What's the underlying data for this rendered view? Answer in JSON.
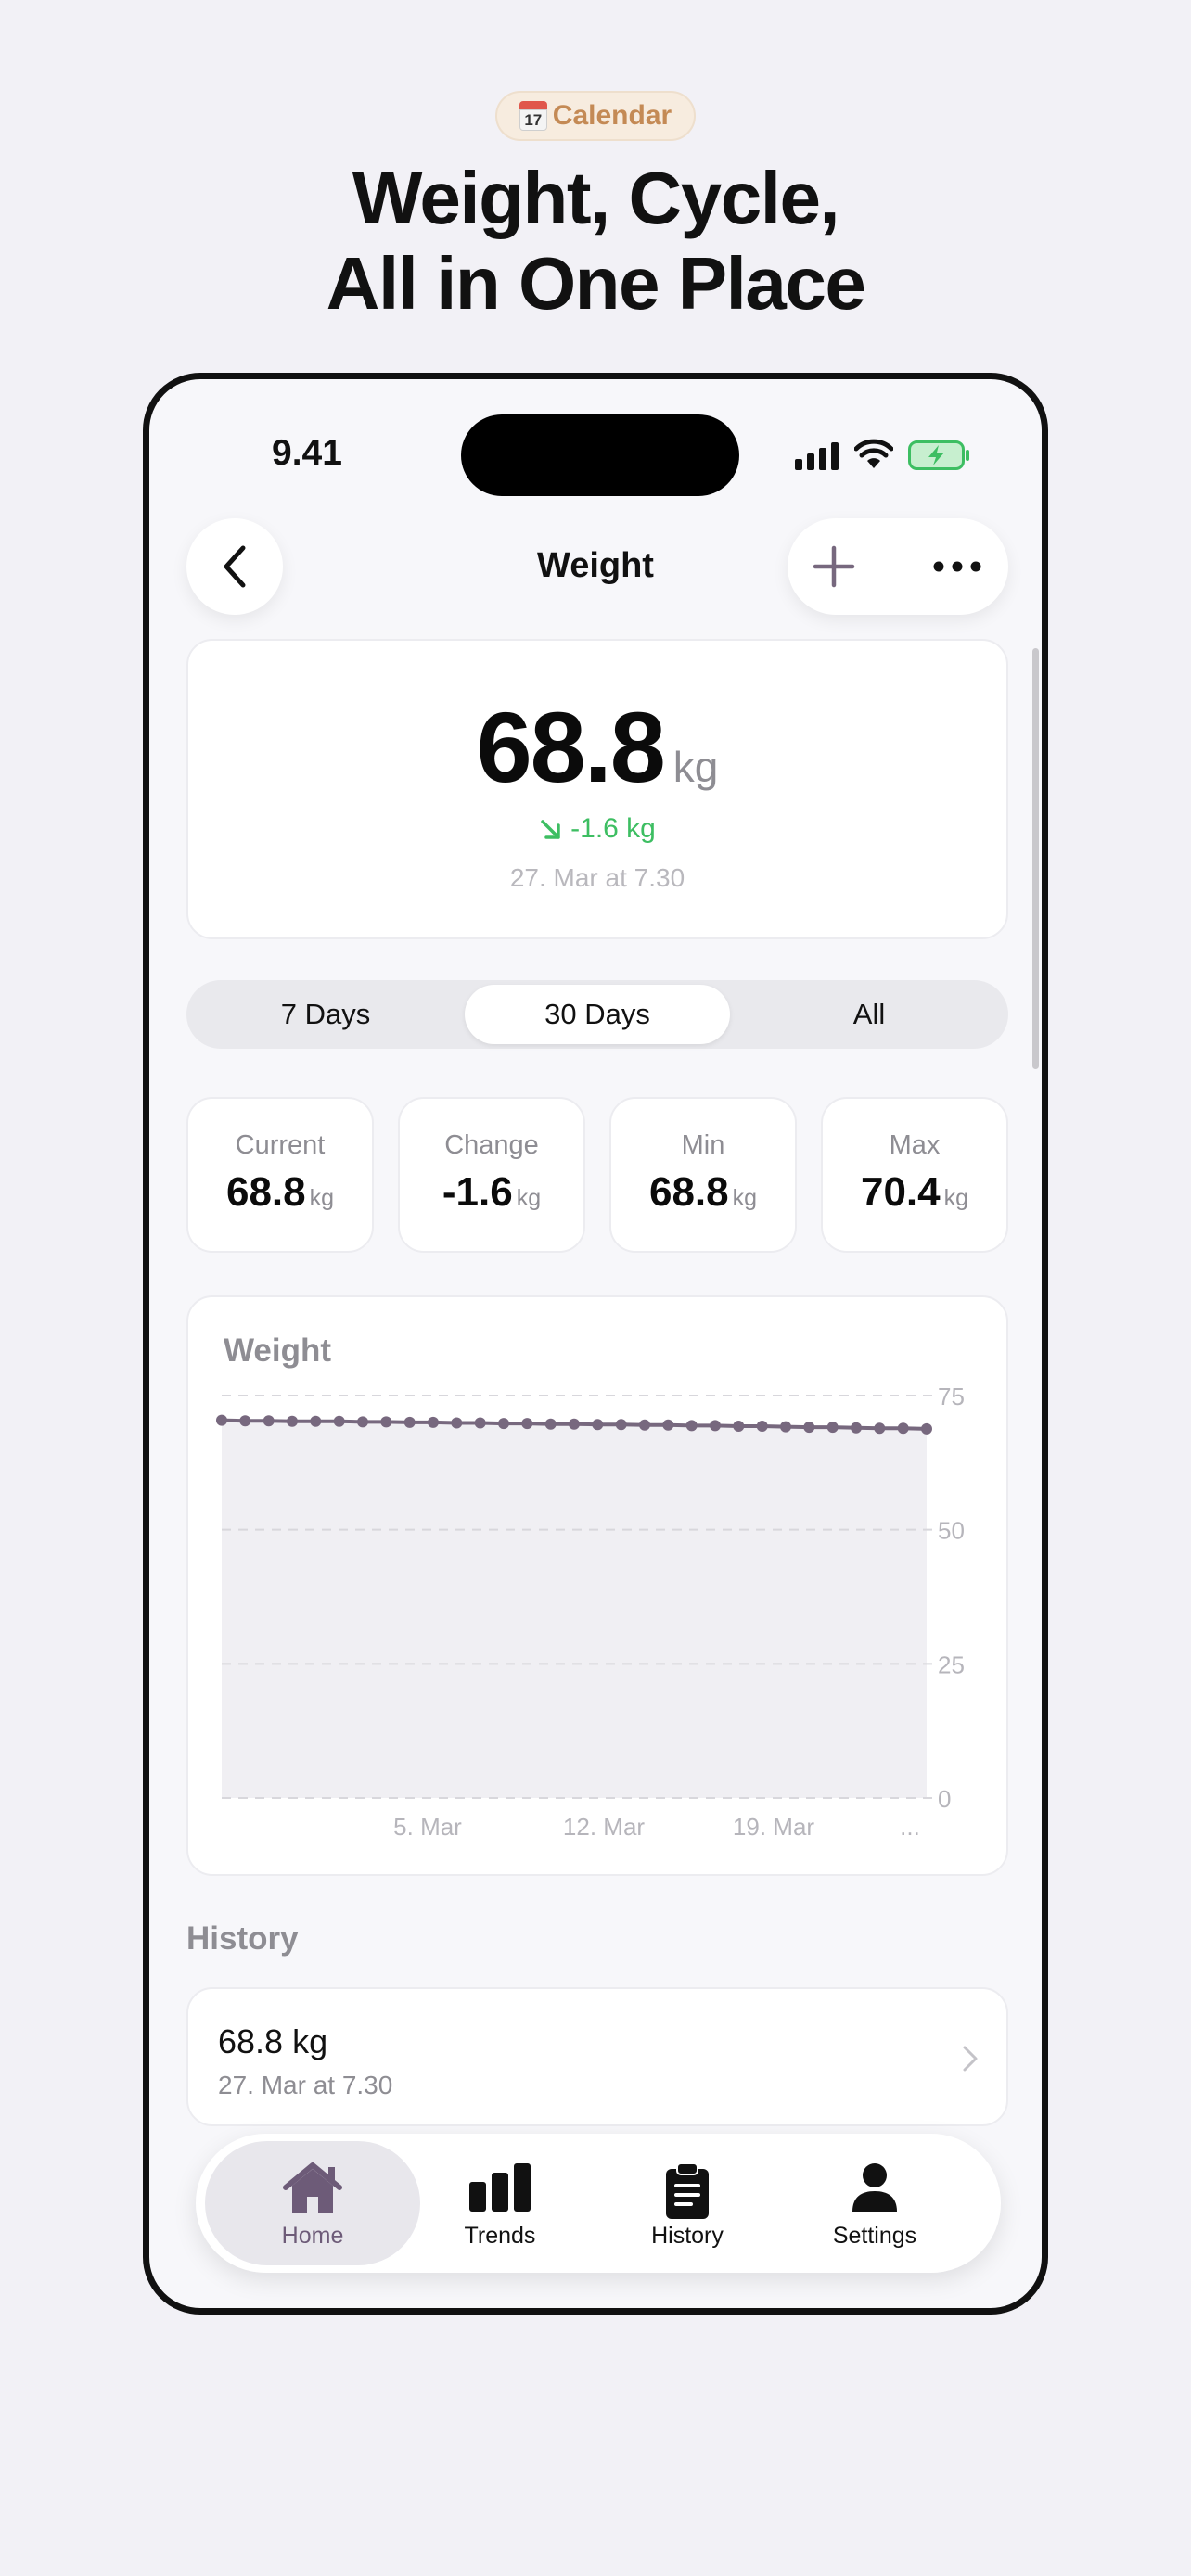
{
  "badge": {
    "icon": "calendar-icon",
    "icon_day": "17",
    "label": "Calendar"
  },
  "headline": {
    "line1": "Weight, Cycle,",
    "line2": "All in One Place"
  },
  "status_bar": {
    "time": "9.41"
  },
  "nav": {
    "title": "Weight",
    "back_icon": "chevron-left-icon",
    "add_icon": "plus-icon",
    "more_icon": "ellipsis-icon"
  },
  "hero": {
    "value": "68.8",
    "unit": "kg",
    "change": "-1.6 kg",
    "date": "27. Mar at 7.30"
  },
  "ranges": {
    "options": [
      "7 Days",
      "30 Days",
      "All"
    ],
    "selected": "30 Days"
  },
  "stats": [
    {
      "label": "Current",
      "value": "68.8",
      "unit": "kg"
    },
    {
      "label": "Change",
      "value": "-1.6",
      "unit": "kg"
    },
    {
      "label": "Min",
      "value": "68.8",
      "unit": "kg"
    },
    {
      "label": "Max",
      "value": "70.4",
      "unit": "kg"
    }
  ],
  "chart_data": {
    "type": "area",
    "title": "Weight",
    "ylim": [
      0,
      75
    ],
    "y_ticks": [
      "75",
      "50",
      "25",
      "0"
    ],
    "x_ticks": [
      "5. Mar",
      "12. Mar",
      "19. Mar",
      "..."
    ],
    "grid": true,
    "series": [
      {
        "values": [
          70.4,
          70.3,
          70.3,
          70.2,
          70.2,
          70.2,
          70.1,
          70.1,
          70.0,
          70.0,
          69.9,
          69.9,
          69.8,
          69.8,
          69.7,
          69.7,
          69.6,
          69.6,
          69.5,
          69.5,
          69.4,
          69.4,
          69.3,
          69.3,
          69.2,
          69.1,
          69.1,
          69.0,
          68.9,
          68.9,
          68.8
        ]
      }
    ],
    "colors": {
      "line": "#77687e",
      "fill": "#f0eff3",
      "grid": "#d8d7dc"
    }
  },
  "history": {
    "title": "History",
    "rows": [
      {
        "value": "68.8 kg",
        "date": "27. Mar at 7.30"
      }
    ]
  },
  "tabbar": {
    "items": [
      {
        "label": "Home",
        "icon": "home-icon",
        "active": true
      },
      {
        "label": "Trends",
        "icon": "bar-chart-icon",
        "active": false
      },
      {
        "label": "History",
        "icon": "clipboard-icon",
        "active": false
      },
      {
        "label": "Settings",
        "icon": "person-icon",
        "active": false
      }
    ]
  },
  "colors": {
    "accent": "#6d5b78",
    "positive": "#3dbe62",
    "badge_text": "#c48a55"
  }
}
